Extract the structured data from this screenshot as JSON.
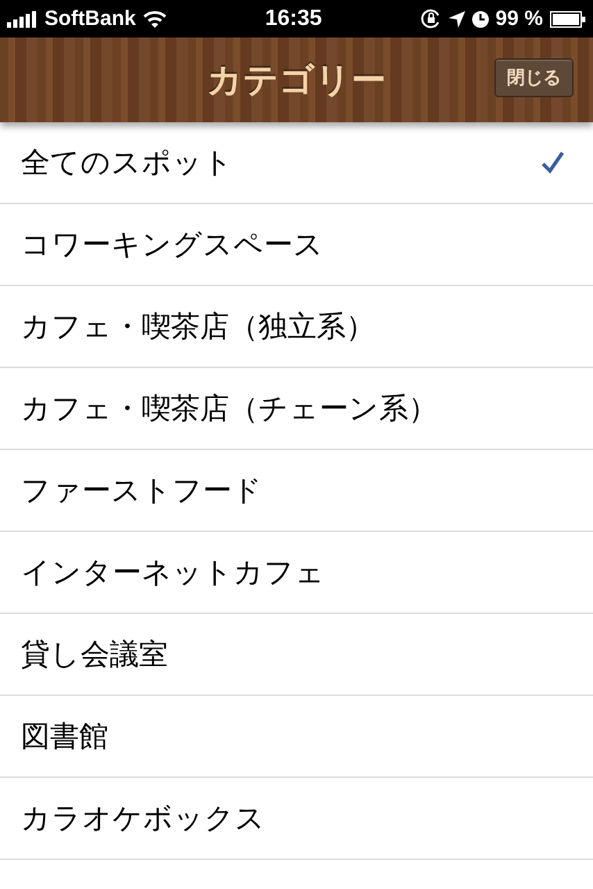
{
  "status_bar": {
    "carrier": "SoftBank",
    "time": "16:35",
    "battery": "99 %"
  },
  "nav_bar": {
    "title": "カテゴリー",
    "close_button": "閉じる"
  },
  "categories": [
    {
      "label": "全てのスポット",
      "selected": true
    },
    {
      "label": "コワーキングスペース",
      "selected": false
    },
    {
      "label": "カフェ・喫茶店（独立系）",
      "selected": false
    },
    {
      "label": "カフェ・喫茶店（チェーン系）",
      "selected": false
    },
    {
      "label": "ファーストフード",
      "selected": false
    },
    {
      "label": "インターネットカフェ",
      "selected": false
    },
    {
      "label": "貸し会議室",
      "selected": false
    },
    {
      "label": "図書館",
      "selected": false
    },
    {
      "label": "カラオケボックス",
      "selected": false
    }
  ]
}
